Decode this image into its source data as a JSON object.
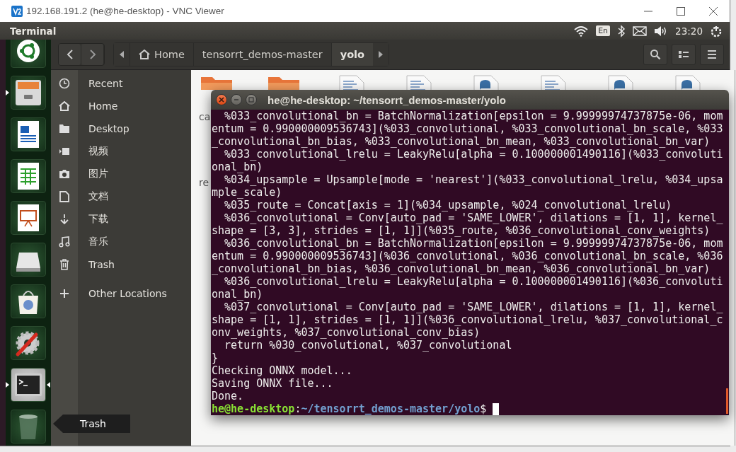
{
  "vnc_window": {
    "title": "192.168.191.2 (he@he-desktop) - VNC Viewer"
  },
  "top_panel": {
    "app_name": "Terminal",
    "keyboard_layout": "En",
    "clock": "23:20"
  },
  "launcher": [
    {
      "running": false,
      "focused": false
    },
    {
      "running": true,
      "focused": false
    },
    {
      "running": false,
      "focused": false
    },
    {
      "running": false,
      "focused": false
    },
    {
      "running": false,
      "focused": false
    },
    {
      "running": false,
      "focused": false
    },
    {
      "running": false,
      "focused": false
    },
    {
      "running": false,
      "focused": false
    },
    {
      "running": true,
      "focused": true
    },
    {
      "running": false,
      "focused": false
    }
  ],
  "launcher_tooltip": "Trash",
  "files": {
    "breadcrumbs": [
      {
        "label": "Home",
        "selected": false
      },
      {
        "label": "tensorrt_demos-master",
        "selected": false
      },
      {
        "label": "yolo",
        "selected": true
      }
    ],
    "sidebar": [
      {
        "label": "Recent"
      },
      {
        "label": "Home"
      },
      {
        "label": "Desktop"
      },
      {
        "label": "视频"
      },
      {
        "label": "图片"
      },
      {
        "label": "文档"
      },
      {
        "label": "下载"
      },
      {
        "label": "音乐"
      },
      {
        "label": "Trash"
      }
    ],
    "other_locations": "Other Locations",
    "items": [
      {
        "kind": "folder",
        "name": "ca"
      },
      {
        "kind": "folder"
      },
      {
        "kind": "document"
      },
      {
        "kind": "document"
      },
      {
        "kind": "python"
      },
      {
        "kind": "document"
      },
      {
        "kind": "python"
      },
      {
        "kind": "python"
      },
      {
        "name": "re"
      }
    ]
  },
  "terminal": {
    "title": "he@he-desktop: ~/tensorrt_demos-master/yolo",
    "lines": [
      "  %033_convolutional_bn = BatchNormalization[epsilon = 9.99999974737875e-06, mom",
      "entum = 0.990000009536743](%033_convolutional, %033_convolutional_bn_scale, %033",
      "_convolutional_bn_bias, %033_convolutional_bn_mean, %033_convolutional_bn_var)",
      "  %033_convolutional_lrelu = LeakyRelu[alpha = 0.100000001490116](%033_convoluti",
      "onal_bn)",
      "  %034_upsample = Upsample[mode = 'nearest'](%033_convolutional_lrelu, %034_upsa",
      "mple_scale)",
      "  %035_route = Concat[axis = 1](%034_upsample, %024_convolutional_lrelu)",
      "  %036_convolutional = Conv[auto_pad = 'SAME_LOWER', dilations = [1, 1], kernel_",
      "shape = [3, 3], strides = [1, 1]](%035_route, %036_convolutional_conv_weights)",
      "  %036_convolutional_bn = BatchNormalization[epsilon = 9.99999974737875e-06, mom",
      "entum = 0.990000009536743](%036_convolutional, %036_convolutional_bn_scale, %036",
      "_convolutional_bn_bias, %036_convolutional_bn_mean, %036_convolutional_bn_var)",
      "  %036_convolutional_lrelu = LeakyRelu[alpha = 0.100000001490116](%036_convoluti",
      "onal_bn)",
      "  %037_convolutional = Conv[auto_pad = 'SAME_LOWER', dilations = [1, 1], kernel_",
      "shape = [1, 1], strides = [1, 1]](%036_convolutional_lrelu, %037_convolutional_c",
      "onv_weights, %037_convolutional_conv_bias)",
      "  return %030_convolutional, %037_convolutional",
      "}",
      "Checking ONNX model...",
      "Saving ONNX file...",
      "Done."
    ],
    "prompt": {
      "user": "he@he-desktop",
      "separator": ":",
      "path": "~/tensorrt_demos-master/yolo",
      "symbol": "$"
    }
  }
}
